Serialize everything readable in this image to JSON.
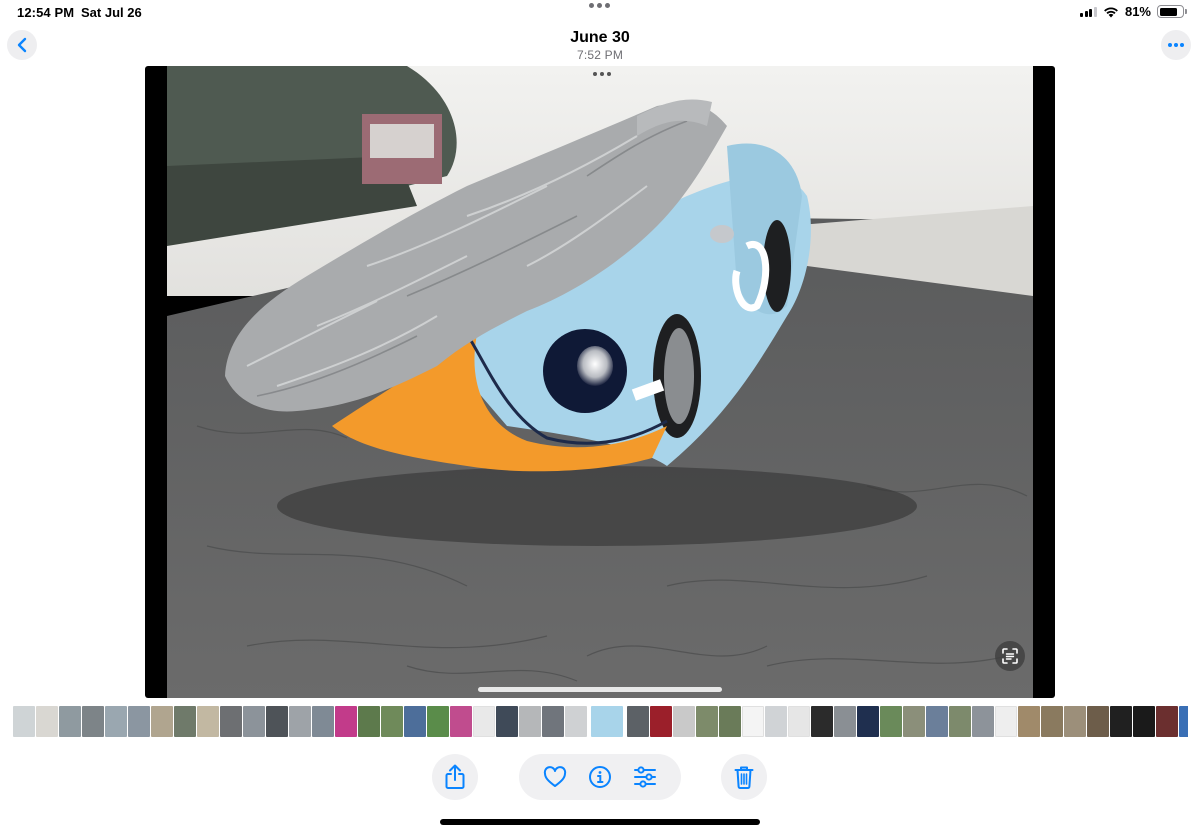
{
  "status_bar": {
    "time": "12:54 PM",
    "date": "Sat Jul 26",
    "battery_percent_label": "81%",
    "battery_level": 0.81
  },
  "nav": {
    "title": "June 30",
    "subtitle": "7:52 PM",
    "back_icon": "chevron-left-icon",
    "more_icon": "ellipsis-icon"
  },
  "toolbar": {
    "share_icon": "share-icon",
    "favorite_icon": "heart-icon",
    "info_icon": "info-icon",
    "adjust_icon": "sliders-icon",
    "delete_icon": "trash-icon"
  },
  "colors": {
    "accent": "#0a84ff",
    "car_blue": "#a8d4ea",
    "car_orange": "#f39a2b",
    "cover_gray": "#a9abad",
    "floor": "#4a4a4a"
  },
  "filmstrip": {
    "thumbs": [
      "#cfd4d6",
      "#d9d7d2",
      "#8f9aa0",
      "#7d8488",
      "#9aa7b0",
      "#8b96a1",
      "#b0a58f",
      "#6f7a6a",
      "#c2b8a2",
      "#6d6f72",
      "#8c939a",
      "#4e5358",
      "#9ea3a8",
      "#7f8a95",
      "#c23b8a",
      "#5d7a4c",
      "#6f8a5a",
      "#4d6e9a",
      "#5a8c4a",
      "#c04c8e",
      "#e9e9e9",
      "#3f4a58",
      "#b5b7b9",
      "#70757c",
      "#cfd1d3",
      "#a8d4ea",
      "#5c6166",
      "#9b1f2a",
      "#c9c9c9",
      "#7d8b6a",
      "#6a7b59",
      "#f4f4f4",
      "#d0d3d6",
      "#e6e6e6",
      "#2b2b2b",
      "#8a8f94",
      "#1f2f4f",
      "#6a8a5a",
      "#8b8f7a",
      "#6b7f9a",
      "#7d8a6c",
      "#8d939a",
      "#eeeeee",
      "#a08a6a",
      "#8a7a5f",
      "#9c8f7a",
      "#6d5d4a",
      "#202020",
      "#1a1a1a",
      "#6b2f2f",
      "#3a6fb5",
      "#8fa37c",
      "#d8dcdf"
    ],
    "current_index": 25
  }
}
